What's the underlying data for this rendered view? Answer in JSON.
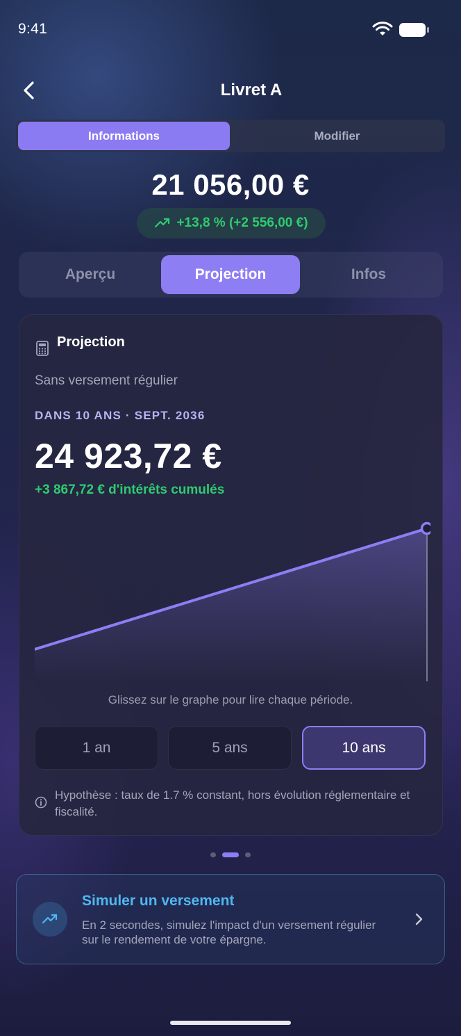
{
  "status_bar": {
    "time": "9:41"
  },
  "header": {
    "title": "Livret A"
  },
  "segment": {
    "informations": "Informations",
    "modifier": "Modifier"
  },
  "balance": {
    "amount": "21 056,00 €",
    "change": "+13,8 % (+2 556,00 €)"
  },
  "tabs": [
    {
      "label": "Aperçu"
    },
    {
      "label": "Projection"
    },
    {
      "label": "Infos"
    }
  ],
  "projection": {
    "title": "Projection",
    "subtitle": "Sans versement régulier",
    "horizon": "DANS 10 ANS · SEPT. 2036",
    "value": "24 923,72 €",
    "interest": "+3 867,72 € d'intérêts cumulés",
    "hint": "Glissez sur le graphe pour lire chaque période.",
    "periods": [
      {
        "label": "1 an"
      },
      {
        "label": "5 ans"
      },
      {
        "label": "10 ans"
      }
    ],
    "selected_period": "10 ans",
    "hypothesis": "Hypothèse : taux de 1.7 % constant, hors évolution réglementaire et fiscalité."
  },
  "chart_data": {
    "type": "line",
    "series": [
      {
        "values": [
          21056.0,
          24923.72
        ]
      }
    ],
    "x": [
      0,
      10
    ]
  },
  "pagination": {
    "count": 3,
    "active": 1
  },
  "simulate": {
    "title": "Simuler un versement",
    "description": "En 2 secondes, simulez l'impact d'un versement régulier sur le rendement de votre épargne."
  },
  "colors": {
    "accent": "#8d7ef3",
    "positive": "#2ecc71",
    "link": "#4fb7f0"
  },
  "icons": {
    "back": "chevron-left-icon",
    "calculator": "calculator-icon",
    "trend": "trend-up-icon",
    "info": "info-icon",
    "next": "chevron-right-icon"
  }
}
